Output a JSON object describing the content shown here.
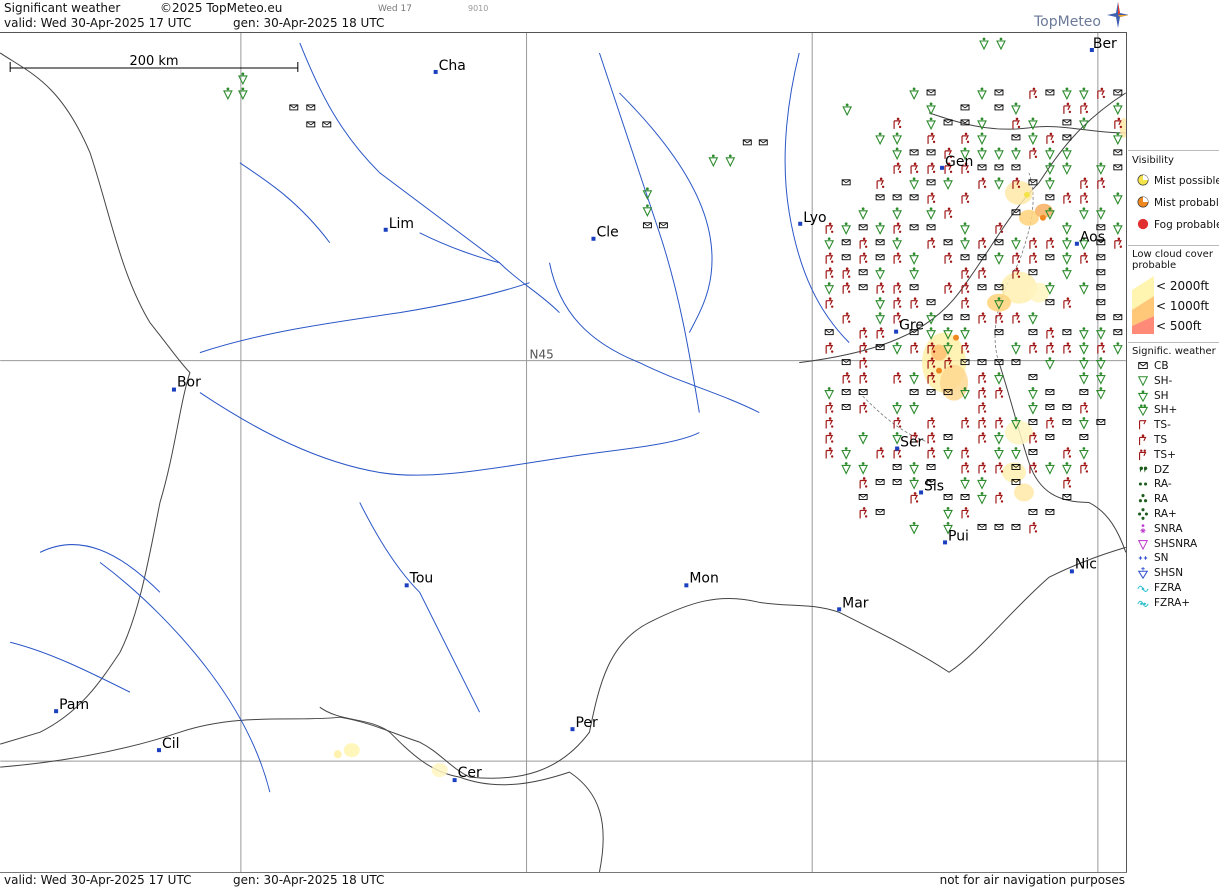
{
  "header": {
    "title": "Significant weather",
    "copyright": "©2025 TopMeteo.eu",
    "valid": "valid:  Wed  30-Apr-2025  17 UTC",
    "generated": "gen:  30-Apr-2025  18 UTC",
    "small_time": "Wed 17",
    "small_code": "9010"
  },
  "footer": {
    "valid": "valid:  Wed  30-Apr-2025  17 UTC",
    "generated": "gen:  30-Apr-2025  18 UTC",
    "disclaimer": "not for air navigation purposes"
  },
  "logo": {
    "text": "TopMeteo"
  },
  "map": {
    "scale_label": "200 km",
    "grid_label": "N45",
    "cities": [
      {
        "name": "Cha"
      },
      {
        "name": "Lim"
      },
      {
        "name": "Cle"
      },
      {
        "name": "Lyo"
      },
      {
        "name": "Gen"
      },
      {
        "name": "Ber"
      },
      {
        "name": "Aos"
      },
      {
        "name": "Gre"
      },
      {
        "name": "Bor"
      },
      {
        "name": "Ser"
      },
      {
        "name": "Sis"
      },
      {
        "name": "Pui"
      },
      {
        "name": "Tou"
      },
      {
        "name": "Mon"
      },
      {
        "name": "Mar"
      },
      {
        "name": "Nic"
      },
      {
        "name": "Pam"
      },
      {
        "name": "Cil"
      },
      {
        "name": "Per"
      },
      {
        "name": "Cer"
      }
    ]
  },
  "legend": {
    "visibility_title": "Visibility",
    "visibility": [
      "Mist possible",
      "Mist probable",
      "Fog probable"
    ],
    "lowcloud_title_1": "Low cloud cover",
    "lowcloud_title_2": "probable",
    "lowcloud": [
      "< 2000ft",
      "< 1000ft",
      "<   500ft"
    ],
    "sigwx_title": "Signific. weather",
    "sigwx": [
      "CB",
      "SH-",
      "SH",
      "SH+",
      "TS-",
      "TS",
      "TS+",
      "DZ",
      "RA-",
      "RA",
      "RA+",
      "SNRA",
      "SHSNRA",
      "SN",
      "SHSN",
      "FZRA",
      "FZRA+"
    ],
    "colors": {
      "mist_possible": "#f5e34a",
      "mist_probable": "#f08a20",
      "fog": "#e03030",
      "shower": "#2e8b2e",
      "thunder": "#a01818",
      "rain": "#1c5c1c",
      "snow": "#c040d0",
      "snow_blue": "#3050d0",
      "fzra": "#30c0d0",
      "lowcloud": "#ffd27a"
    }
  }
}
